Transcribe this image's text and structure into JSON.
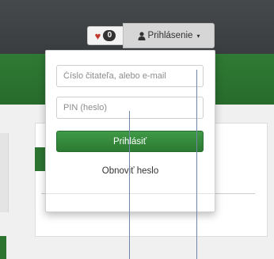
{
  "header": {
    "favorites": {
      "icon": "heart-icon",
      "count": "0"
    },
    "login": {
      "icon": "user-icon",
      "label": "Prihlásenie",
      "caret": "▾"
    }
  },
  "login_form": {
    "reader_field": {
      "placeholder": "Číslo čitateľa, alebo e-mail",
      "value": ""
    },
    "pin_field": {
      "placeholder": "PIN (heslo)",
      "value": ""
    },
    "submit_label": "Prihlásiť",
    "reset_label": "Obnoviť heslo"
  },
  "colors": {
    "topbar": "#3f4245",
    "brand_green": "#2d7431",
    "button_green": "#369040",
    "heart_red": "#c0392b"
  }
}
